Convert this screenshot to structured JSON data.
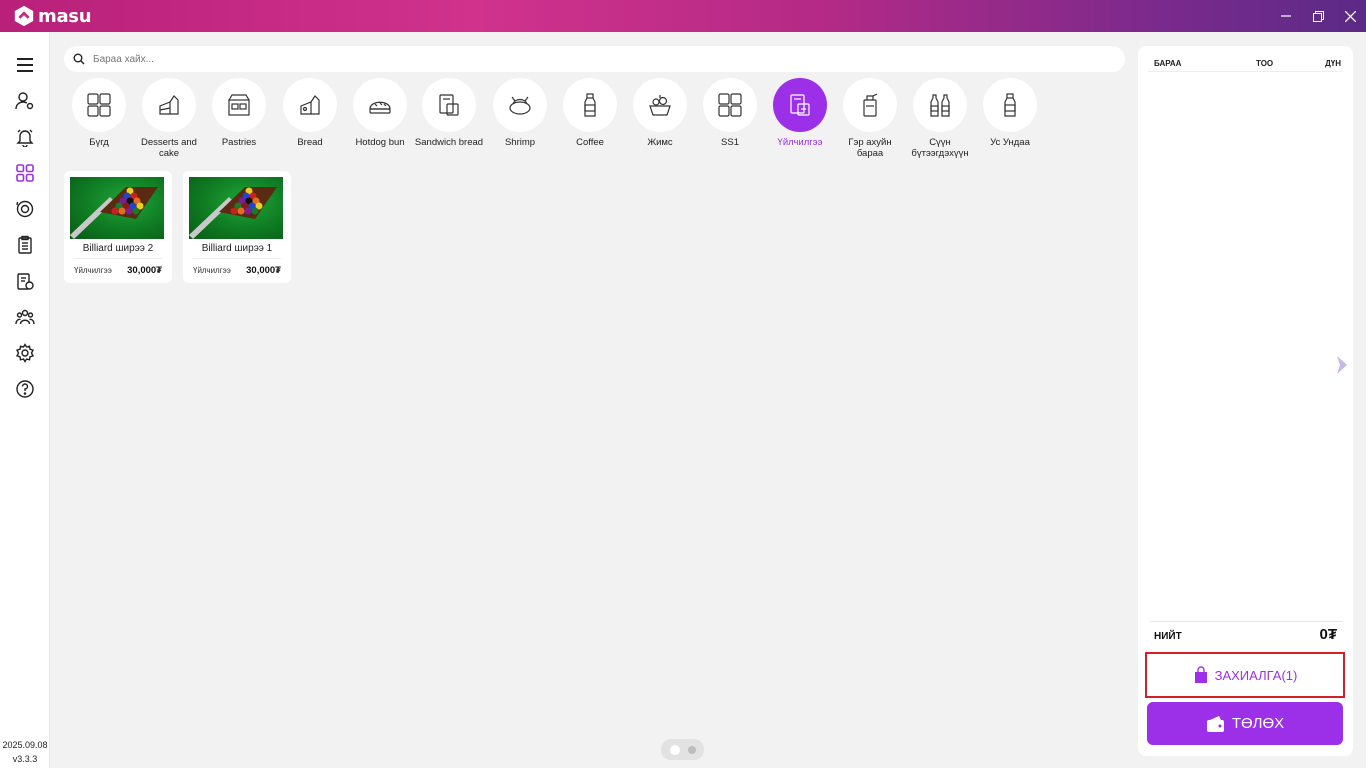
{
  "app": {
    "name": "masu"
  },
  "search": {
    "placeholder": "Бараа хайх..."
  },
  "categories": [
    {
      "label": "Бүгд",
      "icon": "grid-icon"
    },
    {
      "label": "Desserts and cake",
      "icon": "cake-icon"
    },
    {
      "label": "Pastries",
      "icon": "bakery-icon"
    },
    {
      "label": "Bread",
      "icon": "bread-icon"
    },
    {
      "label": "Hotdog bun",
      "icon": "bun-icon"
    },
    {
      "label": "Sandwich bread",
      "icon": "sandwich-icon"
    },
    {
      "label": "Shrimp",
      "icon": "shrimp-icon"
    },
    {
      "label": "Coffee",
      "icon": "bottle-icon"
    },
    {
      "label": "Жимс",
      "icon": "fruit-basket-icon"
    },
    {
      "label": "SS1",
      "icon": "grid-icon"
    },
    {
      "label": "Үйлчилгээ",
      "icon": "service-icon",
      "active": true
    },
    {
      "label": "Гэр ахуйн бараа",
      "icon": "household-icon"
    },
    {
      "label": "Сүүн бүтээгдэхүүн",
      "icon": "milk-bottles-icon"
    },
    {
      "label": "Ус Ундаа",
      "icon": "water-bottle-icon"
    }
  ],
  "products": [
    {
      "name": "Billiard ширээ 2",
      "category": "Үйлчилгээ",
      "price": "30,000₮"
    },
    {
      "name": "Billiard ширээ 1",
      "category": "Үйлчилгээ",
      "price": "30,000₮"
    }
  ],
  "cart": {
    "col_item": "БАРАА",
    "col_qty": "ТОО",
    "col_sum": "ДҮН",
    "total_label": "НИЙТ",
    "total_value": "0₮",
    "order_button": "ЗАХИАЛГА(1)",
    "pay_button": "ТӨЛӨХ"
  },
  "footer": {
    "date": "2025.09.08",
    "version": "v3.3.3"
  },
  "colors": {
    "accent": "#9b30e8",
    "highlight": "#d21f2a"
  }
}
